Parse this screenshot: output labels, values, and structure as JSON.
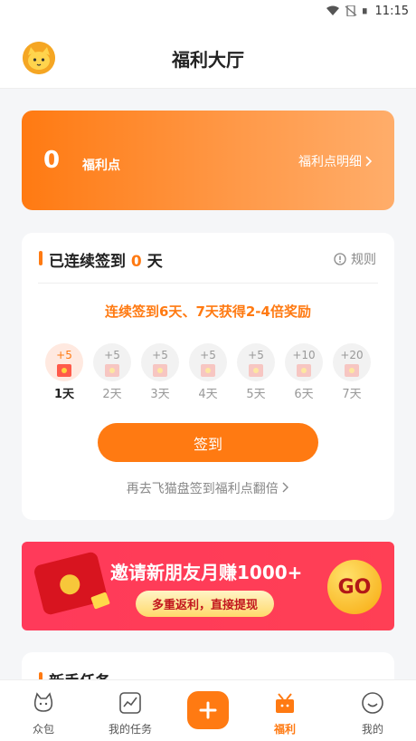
{
  "status_bar": {
    "time": "11:15"
  },
  "header": {
    "title": "福利大厅"
  },
  "points": {
    "value": "0",
    "unit": "福利点",
    "detail_link": "福利点明细"
  },
  "checkin": {
    "streak_prefix": "已连续签到",
    "streak_days": "0",
    "streak_suffix": "天",
    "rules_label": "规则",
    "promo": "连续签到6天、7天获得2-4倍奖励",
    "days": [
      {
        "points": "+5",
        "label": "1天"
      },
      {
        "points": "+5",
        "label": "2天"
      },
      {
        "points": "+5",
        "label": "3天"
      },
      {
        "points": "+5",
        "label": "4天"
      },
      {
        "points": "+5",
        "label": "5天"
      },
      {
        "points": "+10",
        "label": "6天"
      },
      {
        "points": "+20",
        "label": "7天"
      }
    ],
    "button": "签到",
    "link": "再去飞猫盘签到福利点翻倍"
  },
  "invite": {
    "headline": "邀请新朋友月赚1000+",
    "pill": "多重返利，直接提现",
    "go": "GO"
  },
  "newbie": {
    "title": "新手任务"
  },
  "tabbar": [
    {
      "label": "众包",
      "icon": "cat-icon"
    },
    {
      "label": "我的任务",
      "icon": "chart-icon"
    },
    {
      "label": "",
      "icon": "plus-icon"
    },
    {
      "label": "福利",
      "icon": "gift-icon"
    },
    {
      "label": "我的",
      "icon": "smile-icon"
    }
  ],
  "colors": {
    "accent": "#ff7a12",
    "banner_red": "#ff3f55"
  }
}
